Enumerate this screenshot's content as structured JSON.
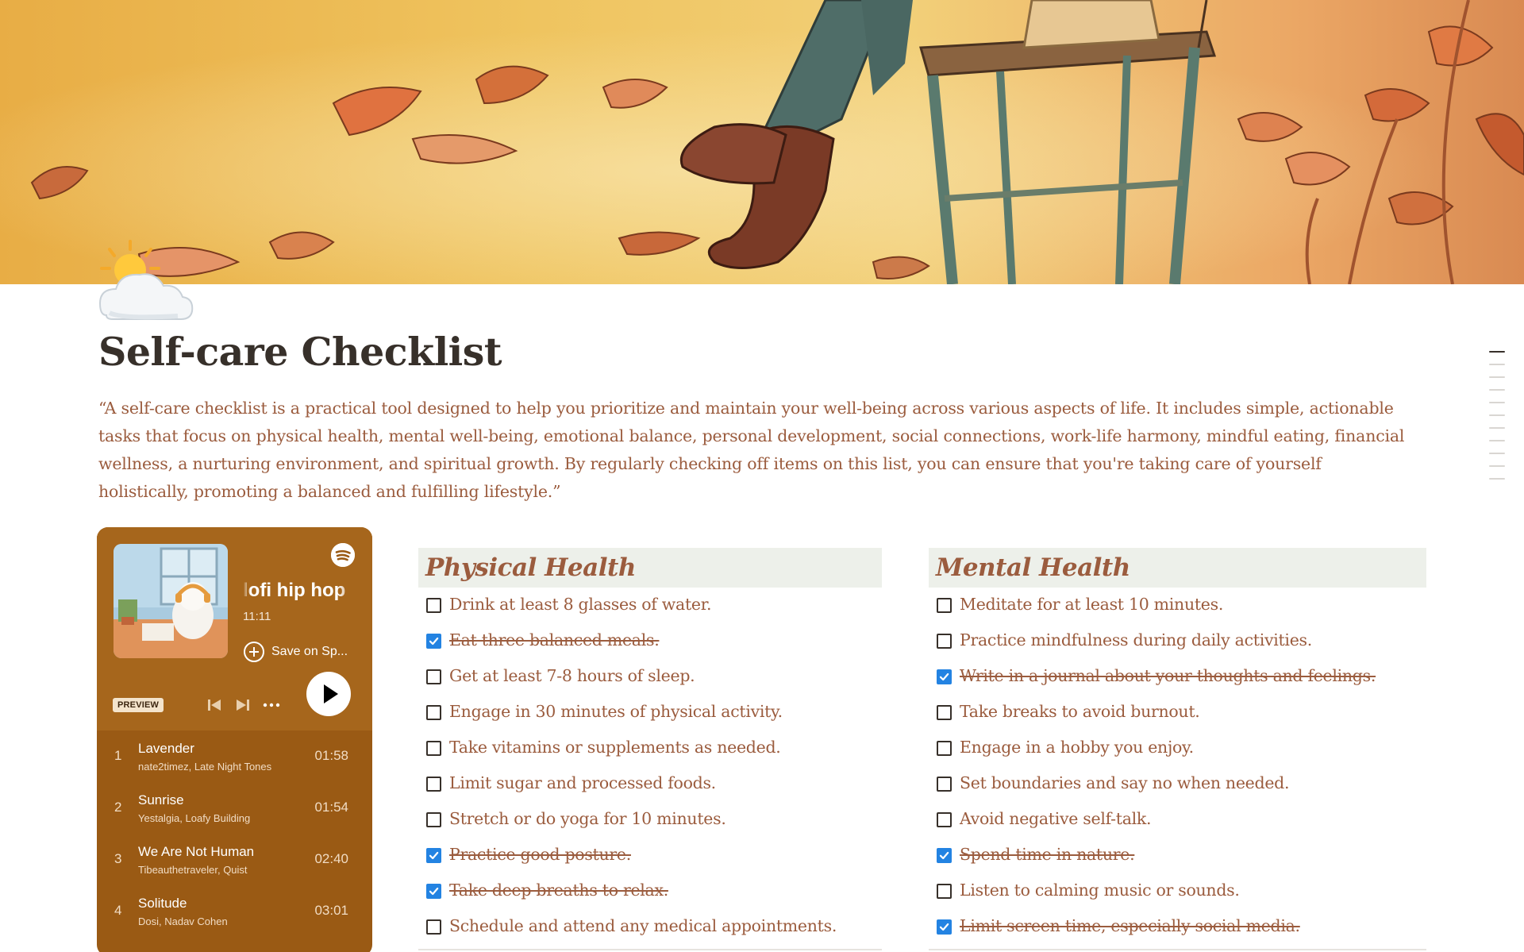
{
  "page": {
    "title": "Self-care Checklist",
    "quote": "“A self-care checklist is a practical tool designed to help you prioritize and maintain your well-being across various aspects of life. It includes simple, actionable tasks that focus on physical health, mental well-being, emotional balance, personal development, social connections, work-life harmony, mindful eating, financial wellness, a nurturing environment, and spiritual growth. By regularly checking off items on this list, you can ensure that you're taking care of yourself holistically, promoting a balanced and fulfilling lifestyle.”",
    "icon": "sun-behind-cloud-icon",
    "cover": "autumn-leaves-illustration"
  },
  "spotify": {
    "playlist_title": "lofi hip hop",
    "duration": "11:11",
    "save_label": "Save on Sp...",
    "preview_label": "PREVIEW",
    "accent": "#9a5a14",
    "tracks": [
      {
        "num": "1",
        "name": "Lavender",
        "artist": "nate2timez, Late Night Tones",
        "duration": "01:58"
      },
      {
        "num": "2",
        "name": "Sunrise",
        "artist": "Yestalgia, Loafy Building",
        "duration": "01:54"
      },
      {
        "num": "3",
        "name": "We Are Not Human",
        "artist": "Tibeauthetraveler, Quist",
        "duration": "02:40"
      },
      {
        "num": "4",
        "name": "Solitude",
        "artist": "Dosi, Nadav Cohen",
        "duration": "03:01"
      }
    ]
  },
  "physical": {
    "heading": "Physical Health",
    "items": [
      {
        "text": "Drink at least 8 glasses of water.",
        "checked": false
      },
      {
        "text": "Eat three balanced meals.",
        "checked": true
      },
      {
        "text": "Get at least 7-8 hours of sleep.",
        "checked": false
      },
      {
        "text": "Engage in 30 minutes of physical activity.",
        "checked": false
      },
      {
        "text": "Take vitamins or supplements as needed.",
        "checked": false
      },
      {
        "text": "Limit sugar and processed foods.",
        "checked": false
      },
      {
        "text": "Stretch or do yoga for 10 minutes.",
        "checked": false
      },
      {
        "text": "Practice good posture.",
        "checked": true
      },
      {
        "text": "Take deep breaths to relax.",
        "checked": true
      },
      {
        "text": "Schedule and attend any medical appointments.",
        "checked": false
      }
    ]
  },
  "mental": {
    "heading": "Mental Health",
    "items": [
      {
        "text": "Meditate for at least 10 minutes.",
        "checked": false
      },
      {
        "text": "Practice mindfulness during daily activities.",
        "checked": false
      },
      {
        "text": "Write in a journal about your thoughts and feelings.",
        "checked": true
      },
      {
        "text": "Take breaks to avoid burnout.",
        "checked": false
      },
      {
        "text": "Engage in a hobby you enjoy.",
        "checked": false
      },
      {
        "text": "Set boundaries and say no when needed.",
        "checked": false
      },
      {
        "text": "Avoid negative self-talk.",
        "checked": false
      },
      {
        "text": "Spend time in nature.",
        "checked": true
      },
      {
        "text": "Listen to calming music or sounds.",
        "checked": false
      },
      {
        "text": "Limit screen time, especially social media.",
        "checked": true
      }
    ]
  },
  "colors": {
    "text_accent": "#9b5c3e",
    "heading_bg": "#edf0ea",
    "checkbox_checked": "#2383e2"
  }
}
